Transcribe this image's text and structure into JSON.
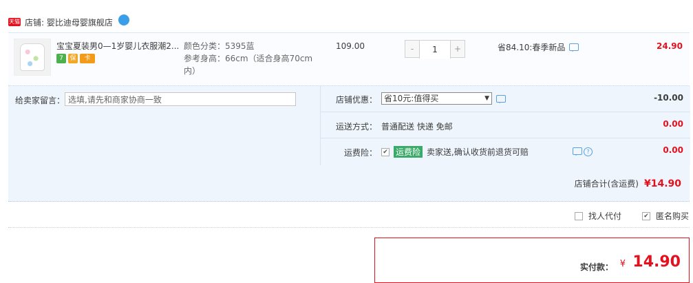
{
  "shop": {
    "tmall_badge": "天猫",
    "label": "店铺: 婴比迪母婴旗舰店"
  },
  "item": {
    "title": "宝宝夏装男0—1岁婴儿衣服潮2...",
    "badges": [
      "7",
      "保",
      "卡"
    ],
    "spec_color": "颜色分类：5395蓝",
    "spec_height": "参考身高：66cm（适合身高70cm内）",
    "price": "109.00",
    "qty_minus": "-",
    "qty_plus": "+",
    "qty": "1",
    "promo": "省84.10:春季新品",
    "subtotal": "24.90"
  },
  "message": {
    "label": "给卖家留言：",
    "placeholder": "选填,请先和商家协商一致"
  },
  "discount": {
    "label": "店铺优惠：",
    "selected": "省10元:值得买",
    "amount": "-10.00"
  },
  "shipping": {
    "label": "运送方式：",
    "value": "普通配送 快递 免邮",
    "amount": "0.00"
  },
  "insurance": {
    "label": "运费险：",
    "tag": "运费险",
    "text": "卖家送,确认收货前退货可赔",
    "amount": "0.00"
  },
  "total": {
    "label": "店铺合计(含运费)",
    "amount": "¥14.90"
  },
  "options": {
    "proxy_pay": "找人代付",
    "anonymous": "匿名购买",
    "anonymous_checked": true
  },
  "pay": {
    "label": "实付款：",
    "yen": "¥",
    "amount": "14.90"
  }
}
